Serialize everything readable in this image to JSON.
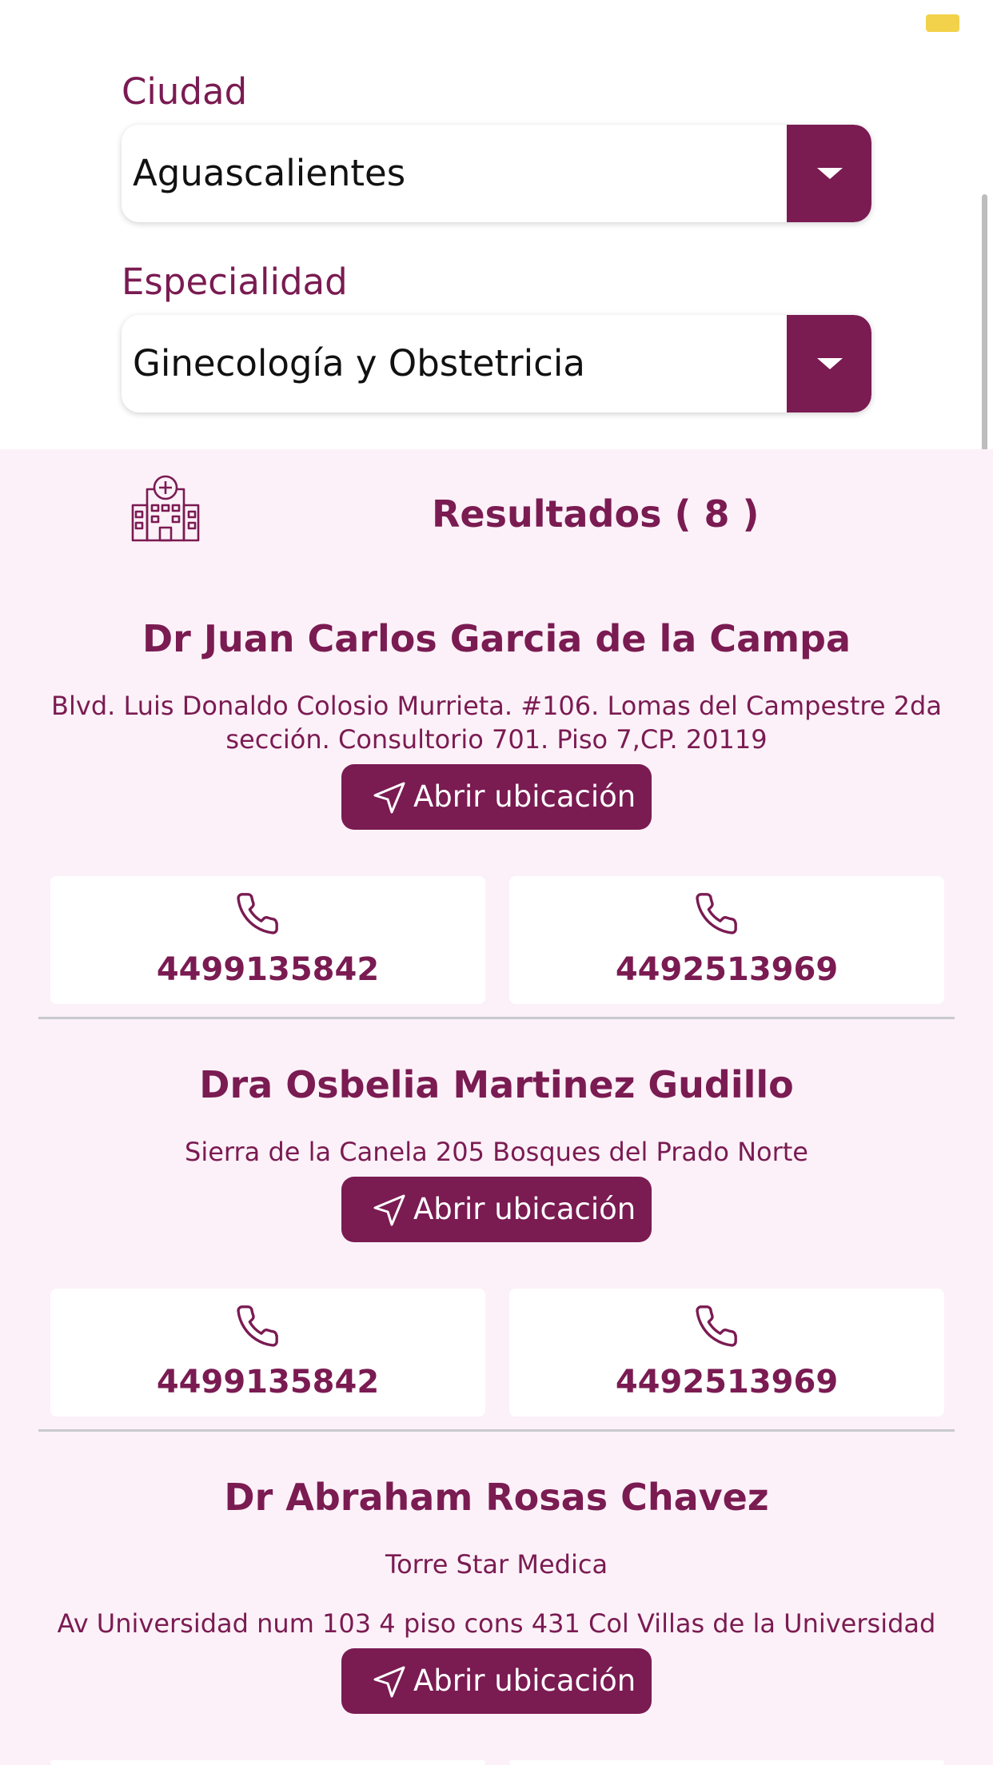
{
  "filters": {
    "city": {
      "label": "Ciudad",
      "value": "Aguascalientes"
    },
    "specialty": {
      "label": "Especialidad",
      "value": "Ginecología y Obstetricia"
    }
  },
  "results": {
    "title": "Resultados ( 8 )",
    "icon": "hospital-icon",
    "location_button_label": "Abrir ubicación",
    "doctors": [
      {
        "name": "Dr Juan Carlos Garcia de la Campa",
        "address_line1": "Blvd. Luis Donaldo Colosio Murrieta. #106. Lomas del Campestre 2da",
        "address_line2": "sección.  Consultorio 701. Piso 7,CP. 20119",
        "phones": [
          "4499135842",
          "4492513969"
        ]
      },
      {
        "name": "Dra Osbelia Martinez Gudillo",
        "address_line1": "Sierra de la Canela 205 Bosques del Prado Norte",
        "phones": [
          "4499135842",
          "4492513969"
        ]
      },
      {
        "name": "Dr Abraham Rosas Chavez",
        "place": "Torre Star Medica",
        "address_line1": "Av Universidad num 103 4 piso cons 431 Col Villas de la Universidad"
      }
    ]
  },
  "colors": {
    "brand": "#7a1b52",
    "results_bg": "#fcf1f8",
    "status_indicator": "#f2d24b"
  }
}
